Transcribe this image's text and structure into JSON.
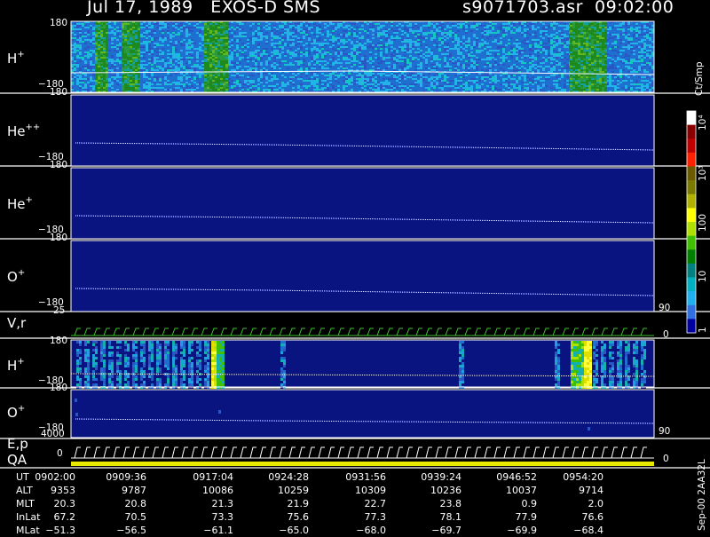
{
  "header": {
    "date_title": "Jul 17, 1989   EXOS-D SMS",
    "file_time": "s9071703.asr  09:02:00"
  },
  "panels": {
    "hplus": {
      "label": "H",
      "sup": "+",
      "top_tick": "180",
      "bottom_tick": "−180"
    },
    "heplusplus": {
      "label": "He",
      "sup": "++",
      "top_tick": "180",
      "bottom_tick": "−180"
    },
    "heplus": {
      "label": "He",
      "sup": "+",
      "top_tick": "180",
      "bottom_tick": "−180"
    },
    "oplus": {
      "label": "O",
      "sup": "+",
      "top_tick": "180",
      "bottom_tick": "−180",
      "right_tick": "90"
    },
    "vr": {
      "label": "V,r",
      "top_tick": "25",
      "right_tick": "0"
    },
    "hplus2": {
      "label": "H",
      "sup": "+",
      "top_tick": "180",
      "bottom_tick": "−180"
    },
    "oplus2": {
      "label": "O",
      "sup": "+",
      "top_tick": "180",
      "bottom_tick": "−180",
      "right_tick": "90"
    },
    "ep": {
      "label": "E,p",
      "top_tick": "4000",
      "mid_tick": "0",
      "right_tick": "0"
    },
    "qa": {
      "label": "QA"
    }
  },
  "colorbar": {
    "unit": "Ct/Smp",
    "labels": [
      "10⁴",
      "10³",
      "100",
      "10",
      "1"
    ],
    "label_values": [
      10000,
      1000,
      100,
      10,
      1
    ],
    "colors": [
      "#ffffff",
      "#8b0000",
      "#c00000",
      "#ff2000",
      "#6b5a00",
      "#7a7a00",
      "#b0b000",
      "#ffff00",
      "#b0e000",
      "#40c000",
      "#008000",
      "#008080",
      "#00b0c0",
      "#20b0f0",
      "#3070e0",
      "#0000a0"
    ]
  },
  "footer": {
    "rows": [
      {
        "name": "UT",
        "values": [
          "0902:00",
          "0909:36",
          "0917:04",
          "0924:28",
          "0931:56",
          "0939:24",
          "0946:52",
          "0954:20"
        ]
      },
      {
        "name": "ALT",
        "values": [
          "9353",
          "9787",
          "10086",
          "10259",
          "10309",
          "10236",
          "10037",
          "9714"
        ]
      },
      {
        "name": "MLT",
        "values": [
          "20.3",
          "20.8",
          "21.3",
          "21.9",
          "22.7",
          "23.8",
          "0.9",
          "2.0"
        ]
      },
      {
        "name": "InLat",
        "values": [
          "67.2",
          "70.5",
          "73.3",
          "75.6",
          "77.3",
          "78.1",
          "77.9",
          "76.6"
        ]
      },
      {
        "name": "MLat",
        "values": [
          "−51.3",
          "−56.5",
          "−61.1",
          "−65.0",
          "−68.0",
          "−69.7",
          "−69.9",
          "−68.4"
        ]
      }
    ],
    "version": "Sep-00  2AA32L"
  },
  "chart_data": {
    "type": "heatmap",
    "title": "Jul 17, 1989   EXOS-D SMS",
    "x_ticks": [
      "0902:00",
      "0909:36",
      "0917:04",
      "0924:28",
      "0931:56",
      "0939:24",
      "0946:52",
      "0954:20"
    ],
    "ylim": [
      -180,
      180
    ],
    "colorbar_unit": "Ct/Smp",
    "colorbar_range": [
      1,
      10000
    ],
    "colorbar_scale": "log",
    "series": [
      {
        "name": "H+",
        "ylim": [
          -180,
          180
        ]
      },
      {
        "name": "He++",
        "ylim": [
          -180,
          180
        ]
      },
      {
        "name": "He+",
        "ylim": [
          -180,
          180
        ]
      },
      {
        "name": "O+",
        "ylim": [
          -180,
          180
        ]
      },
      {
        "name": "V,r",
        "ylim": [
          0,
          25
        ]
      },
      {
        "name": "H+",
        "ylim": [
          -180,
          180
        ]
      },
      {
        "name": "O+",
        "ylim": [
          -180,
          180
        ]
      },
      {
        "name": "E,p",
        "ylim": [
          0,
          4000
        ]
      },
      {
        "name": "QA"
      }
    ]
  }
}
